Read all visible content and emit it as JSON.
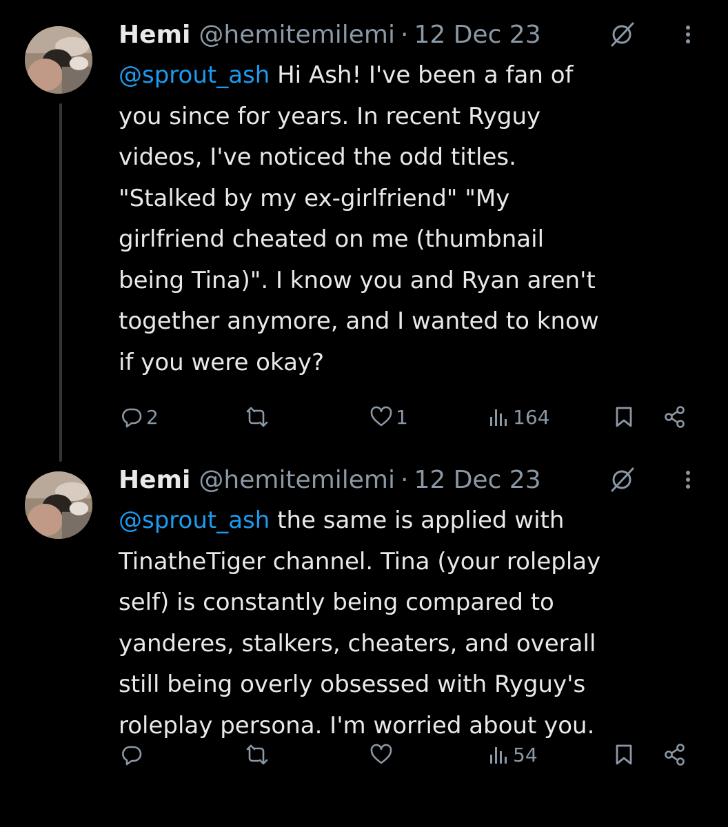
{
  "theme": {
    "background": "#000000",
    "text": "#e7e9ea",
    "secondary": "#8b98a5",
    "mention": "#1d9bf0"
  },
  "tweets": [
    {
      "name": "Hemi",
      "handle": "@hemitemilemi",
      "separator": "·",
      "date": "12 Dec 23",
      "mention": "@sprout_ash",
      "text_lines": [
        " Hi Ash! I've been a fan of",
        "you since for years. In recent Ryguy",
        "videos, I've noticed the odd titles.",
        "\"Stalked by my ex-girlfriend\" \"My",
        "girlfriend cheated on me (thumbnail",
        "being Tina)\". I know you and Ryan aren't",
        "together anymore, and I wanted to know",
        "if you were okay?"
      ],
      "actions": {
        "reply_icon": "reply-icon",
        "reply_count": "2",
        "repost_icon": "repost-icon",
        "repost_count": "",
        "like_icon": "heart-icon",
        "like_count": "1",
        "views_icon": "views-icon",
        "views_count": "164",
        "bookmark_icon": "bookmark-icon",
        "share_icon": "share-icon"
      }
    },
    {
      "name": "Hemi",
      "handle": "@hemitemilemi",
      "separator": "·",
      "date": "12 Dec 23",
      "mention": "@sprout_ash",
      "text_lines": [
        " the same is applied with",
        "TinatheTiger channel. Tina (your roleplay",
        "self) is constantly being compared to",
        "yanderes, stalkers, cheaters, and overall",
        "still being overly obsessed with Ryguy's",
        "roleplay persona. I'm worried about you."
      ],
      "actions": {
        "reply_icon": "reply-icon",
        "reply_count": "",
        "repost_icon": "repost-icon",
        "repost_count": "",
        "like_icon": "heart-icon",
        "like_count": "",
        "views_icon": "views-icon",
        "views_count": "54",
        "bookmark_icon": "bookmark-icon",
        "share_icon": "share-icon"
      }
    }
  ]
}
